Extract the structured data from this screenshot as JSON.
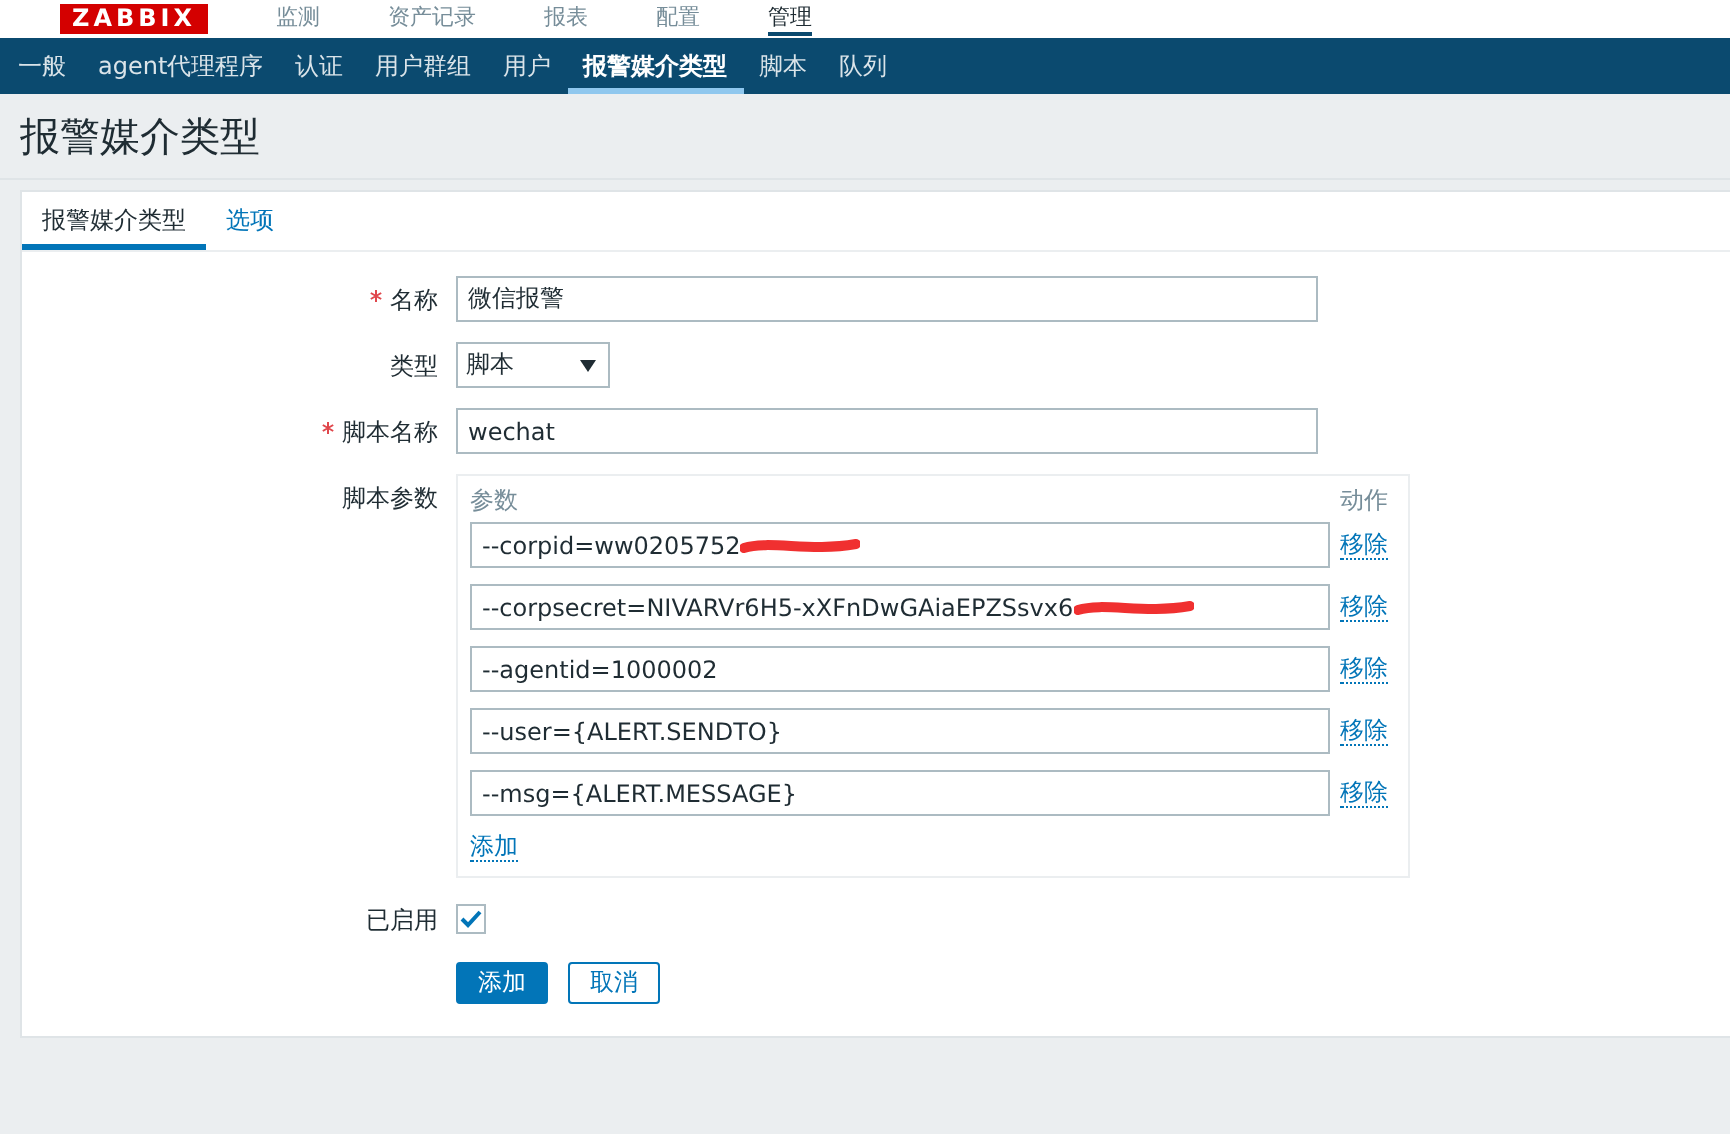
{
  "top_menu": {
    "logo": "ZABBIX",
    "items": [
      {
        "label": "监测",
        "selected": false
      },
      {
        "label": "资产记录",
        "selected": false
      },
      {
        "label": "报表",
        "selected": false
      },
      {
        "label": "配置",
        "selected": false
      },
      {
        "label": "管理",
        "selected": true
      }
    ]
  },
  "sub_menu": [
    {
      "label": "一般",
      "selected": false
    },
    {
      "label": "agent代理程序",
      "selected": false
    },
    {
      "label": "认证",
      "selected": false
    },
    {
      "label": "用户群组",
      "selected": false
    },
    {
      "label": "用户",
      "selected": false
    },
    {
      "label": "报警媒介类型",
      "selected": true
    },
    {
      "label": "脚本",
      "selected": false
    },
    {
      "label": "队列",
      "selected": false
    }
  ],
  "page_title": "报警媒介类型",
  "tabs": [
    {
      "label": "报警媒介类型",
      "selected": true
    },
    {
      "label": "选项",
      "selected": false
    }
  ],
  "form": {
    "name": {
      "label": "名称",
      "required": true,
      "value": "微信报警"
    },
    "type": {
      "label": "类型",
      "value": "脚本"
    },
    "script_name": {
      "label": "脚本名称",
      "required": true,
      "value": "wechat"
    },
    "script_params": {
      "label": "脚本参数",
      "column_param": "参数",
      "column_action": "动作",
      "add_link": "添加",
      "rows": [
        {
          "value": "--corpid=ww0205752",
          "redacted": true,
          "action": "移除"
        },
        {
          "value": "--corpsecret=NIVARVr6H5-xXFnDwGAiaEPZSsvx6",
          "redacted": true,
          "action": "移除"
        },
        {
          "value": "--agentid=1000002",
          "redacted": false,
          "action": "移除"
        },
        {
          "value": "--user={ALERT.SENDTO}",
          "redacted": false,
          "action": "移除"
        },
        {
          "value": "--msg={ALERT.MESSAGE}",
          "redacted": false,
          "action": "移除"
        }
      ]
    },
    "enabled": {
      "label": "已启用",
      "checked": true
    }
  },
  "buttons": [
    {
      "label": "添加",
      "kind": "primary"
    },
    {
      "label": "取消",
      "kind": "secondary"
    }
  ]
}
